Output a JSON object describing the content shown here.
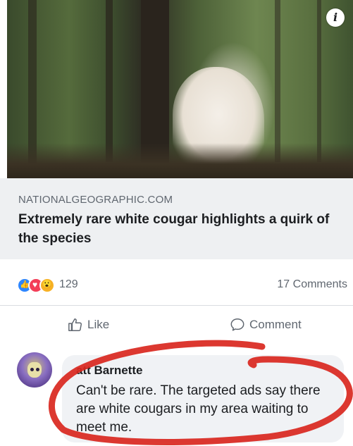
{
  "post": {
    "image": {
      "info_icon": "i"
    },
    "link": {
      "domain": "NATIONALGEOGRAPHIC.COM",
      "title": "Extremely rare white cougar highlights a quirk of the species"
    },
    "reactions": {
      "icons": [
        "like-reaction-icon",
        "love-reaction-icon",
        "wow-reaction-icon"
      ],
      "count": "129",
      "comments": "17 Comments"
    },
    "actions": {
      "like": "Like",
      "comment": "Comment"
    }
  },
  "comment": {
    "author": "att Barnette",
    "text": "Can't be rare. The targeted ads say there are white cougars in my area waiting to meet me."
  },
  "colors": {
    "annotation_red": "#d9271e",
    "reaction_like": "#2d86ff",
    "reaction_love": "#f33e58",
    "reaction_wow": "#f7b125"
  }
}
